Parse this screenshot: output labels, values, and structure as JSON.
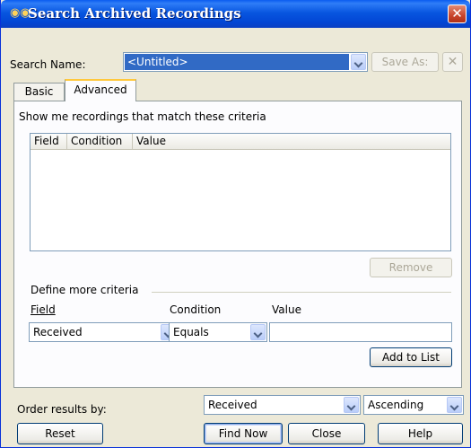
{
  "window": {
    "title": "Search Archived Recordings",
    "close_glyph": "✕",
    "icon": "binoculars-icon"
  },
  "search_name": {
    "label": "Search Name:",
    "value": "<Untitled>",
    "save_as_label": "Save As:",
    "delete_glyph": "✕"
  },
  "tabs": [
    {
      "label": "Basic",
      "selected": false
    },
    {
      "label": "Advanced",
      "selected": true
    }
  ],
  "criteria": {
    "heading": "Show me recordings that match these criteria",
    "columns": [
      "Field",
      "Condition",
      "Value"
    ],
    "rows": [],
    "remove_label": "Remove"
  },
  "define": {
    "heading": "Define more criteria",
    "field_label": "Field",
    "condition_label": "Condition",
    "value_label": "Value",
    "field_value": "Received",
    "condition_value": "Equals",
    "value_value": "",
    "add_label": "Add to List"
  },
  "order": {
    "label": "Order results by:",
    "field": "Received",
    "direction": "Ascending"
  },
  "buttons": {
    "reset": "Reset",
    "find_now": "Find Now",
    "close": "Close",
    "help": "Help"
  },
  "colors": {
    "title_bar": "#0a5cf0",
    "selection": "#316ac5",
    "tab_highlight": "#ffc83c",
    "close_button": "#c8452c"
  }
}
